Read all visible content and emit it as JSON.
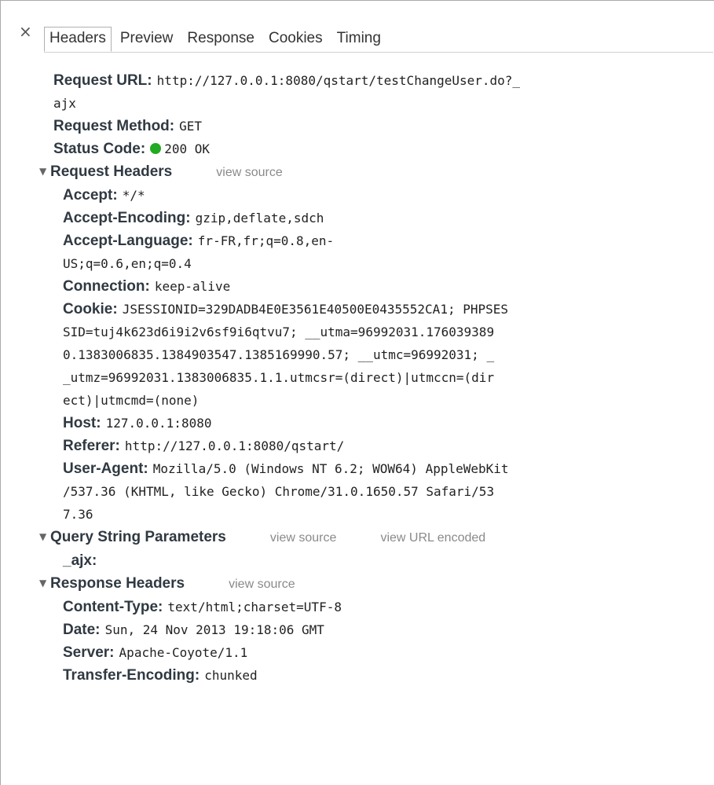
{
  "tabs": [
    "Headers",
    "Preview",
    "Response",
    "Cookies",
    "Timing"
  ],
  "general": {
    "request_url_label": "Request URL:",
    "request_url_line1": "http://127.0.0.1:8080/qstart/testChangeUser.do?_",
    "request_url_line2": "ajx",
    "request_method_label": "Request Method:",
    "request_method": "GET",
    "status_code_label": "Status Code:",
    "status_code": "200 OK",
    "status_color": "#22aa22"
  },
  "request_headers": {
    "title": "Request Headers",
    "view_source": "view source",
    "rows": [
      {
        "k": "Accept:",
        "lines": [
          "*/*"
        ]
      },
      {
        "k": "Accept-Encoding:",
        "lines": [
          "gzip,deflate,sdch"
        ]
      },
      {
        "k": "Accept-Language:",
        "lines": [
          "fr-FR,fr;q=0.8,en-",
          "US;q=0.6,en;q=0.4"
        ]
      },
      {
        "k": "Connection:",
        "lines": [
          "keep-alive"
        ]
      },
      {
        "k": "Cookie:",
        "lines": [
          "JSESSIONID=329DADB4E0E3561E40500E0435552CA1; PHPSES",
          "SID=tuj4k623d6i9i2v6sf9i6qtvu7; __utma=96992031.176039389",
          "0.1383006835.1384903547.1385169990.57; __utmc=96992031; _",
          "_utmz=96992031.1383006835.1.1.utmcsr=(direct)|utmccn=(dir",
          "ect)|utmcmd=(none)"
        ]
      },
      {
        "k": "Host:",
        "lines": [
          "127.0.0.1:8080"
        ]
      },
      {
        "k": "Referer:",
        "lines": [
          "http://127.0.0.1:8080/qstart/"
        ]
      },
      {
        "k": "User-Agent:",
        "lines": [
          "Mozilla/5.0 (Windows NT 6.2; WOW64) AppleWebKit",
          "/537.36 (KHTML, like Gecko) Chrome/31.0.1650.57 Safari/53",
          "7.36"
        ]
      }
    ]
  },
  "query_string": {
    "title": "Query String Parameters",
    "view_source": "view source",
    "view_url_encoded": "view URL encoded",
    "rows": [
      {
        "k": "_ajx:",
        "lines": [
          ""
        ]
      }
    ]
  },
  "response_headers": {
    "title": "Response Headers",
    "view_source": "view source",
    "rows": [
      {
        "k": "Content-Type:",
        "lines": [
          "text/html;charset=UTF-8"
        ]
      },
      {
        "k": "Date:",
        "lines": [
          "Sun, 24 Nov 2013 19:18:06 GMT"
        ]
      },
      {
        "k": "Server:",
        "lines": [
          "Apache-Coyote/1.1"
        ]
      },
      {
        "k": "Transfer-Encoding:",
        "lines": [
          "chunked"
        ]
      }
    ]
  }
}
